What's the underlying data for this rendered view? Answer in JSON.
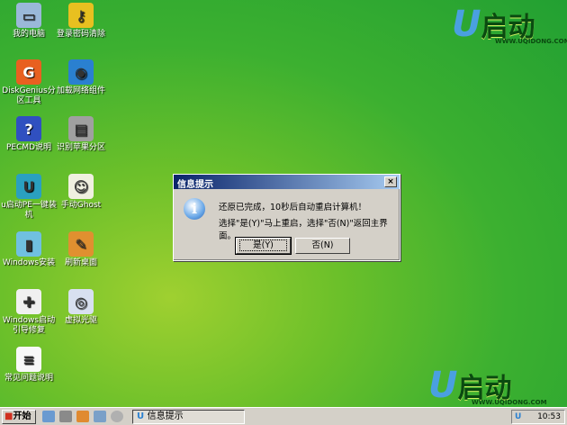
{
  "desktop_icons": [
    {
      "label": "我的电脑",
      "icon": "computer-icon"
    },
    {
      "label": "登录密码清除",
      "icon": "key-icon"
    },
    {
      "label": "DiskGenius分区工具",
      "icon": "diskgenius-icon"
    },
    {
      "label": "加载网络组件",
      "icon": "network-globe-icon"
    },
    {
      "label": "PECMD说明",
      "icon": "help-icon"
    },
    {
      "label": "识别苹果分区",
      "icon": "hard-drive-icon"
    },
    {
      "label": "u启动PE一键装机",
      "icon": "u-logo-icon"
    },
    {
      "label": "手动Ghost",
      "icon": "ghost-icon"
    },
    {
      "label": "Windows安装",
      "icon": "windows-install-icon"
    },
    {
      "label": "刷新桌面",
      "icon": "refresh-desktop-icon"
    },
    {
      "label": "Windows启动引导修复",
      "icon": "first-aid-icon"
    },
    {
      "label": "虚拟光驱",
      "icon": "virtual-cdrom-icon"
    },
    {
      "label": "常见问题说明",
      "icon": "document-icon"
    }
  ],
  "logo": {
    "text": "启动",
    "url": "WWW.UQIDONG.COM"
  },
  "dialog": {
    "title": "信息提示",
    "line1": "还原已完成，10秒后自动重启计算机！",
    "line2": "选择\"是(Y)\"马上重启，选择\"否(N)\"返回主界面。",
    "yes": "是(Y)",
    "no": "否(N)",
    "close": "×"
  },
  "taskbar": {
    "start": "开始",
    "task": "信息提示",
    "time": "10:53"
  }
}
